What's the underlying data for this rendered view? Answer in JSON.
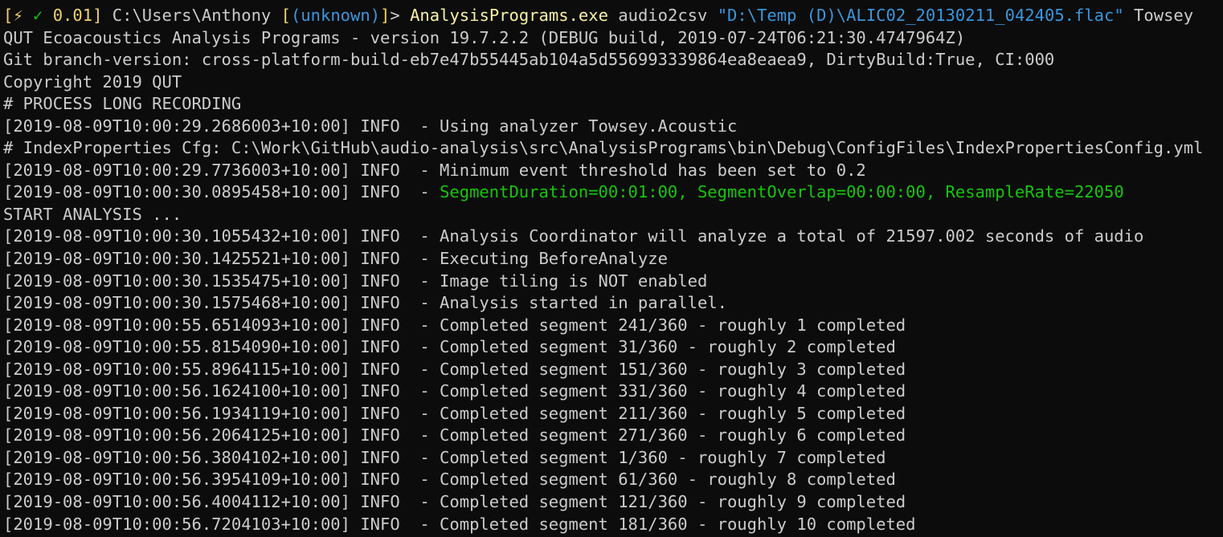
{
  "prompt": {
    "open_bracket": "[",
    "bolt": "⚡",
    "check": "✓",
    "duration": "0.01",
    "close_bracket": "]",
    "path": " C:\\Users\\Anthony ",
    "git_open": "[",
    "git_status": "(unknown)",
    "git_close": "]",
    "gt": "> ",
    "executable": "AnalysisPrograms.exe",
    "args_before": " audio2csv ",
    "quoted_arg": "\"D:\\Temp (D)\\ALIC02_20130211_042405.flac\"",
    "args_after": " Towsey"
  },
  "output": {
    "line_1": "QUT Ecoacoustics Analysis Programs - version 19.7.2.2 (DEBUG build, 2019-07-24T06:21:30.4747964Z)",
    "line_2": "Git branch-version: cross-platform-build-eb7e47b55445ab104a5d556993339864ea8eaea9, DirtyBuild:True, CI:000",
    "line_3": "Copyright 2019 QUT",
    "line_4": "# PROCESS LONG RECORDING",
    "line_5": "[2019-08-09T10:00:29.2686003+10:00] INFO  - Using analyzer Towsey.Acoustic",
    "line_6": "# IndexProperties Cfg: C:\\Work\\GitHub\\audio-analysis\\src\\AnalysisPrograms\\bin\\Debug\\ConfigFiles\\IndexPropertiesConfig.yml",
    "line_7": "[2019-08-09T10:00:29.7736003+10:00] INFO  - Minimum event threshold has been set to 0.2",
    "line_8_prefix": "[2019-08-09T10:00:30.0895458+10:00] INFO  - ",
    "line_8_highlight": "SegmentDuration=00:01:00, SegmentOverlap=00:00:00, ResampleRate=22050",
    "line_9": "START ANALYSIS ...",
    "line_10": "[2019-08-09T10:00:30.1055432+10:00] INFO  - Analysis Coordinator will analyze a total of 21597.002 seconds of audio",
    "line_11": "[2019-08-09T10:00:30.1425521+10:00] INFO  - Executing BeforeAnalyze",
    "line_12": "[2019-08-09T10:00:30.1535475+10:00] INFO  - Image tiling is NOT enabled",
    "line_13": "[2019-08-09T10:00:30.1575468+10:00] INFO  - Analysis started in parallel.",
    "line_14": "[2019-08-09T10:00:55.6514093+10:00] INFO  - Completed segment 241/360 - roughly 1 completed",
    "line_15": "[2019-08-09T10:00:55.8154090+10:00] INFO  - Completed segment 31/360 - roughly 2 completed",
    "line_16": "[2019-08-09T10:00:55.8964115+10:00] INFO  - Completed segment 151/360 - roughly 3 completed",
    "line_17": "[2019-08-09T10:00:56.1624100+10:00] INFO  - Completed segment 331/360 - roughly 4 completed",
    "line_18": "[2019-08-09T10:00:56.1934119+10:00] INFO  - Completed segment 211/360 - roughly 5 completed",
    "line_19": "[2019-08-09T10:00:56.2064125+10:00] INFO  - Completed segment 271/360 - roughly 6 completed",
    "line_20": "[2019-08-09T10:00:56.3804102+10:00] INFO  - Completed segment 1/360 - roughly 7 completed",
    "line_21": "[2019-08-09T10:00:56.3954109+10:00] INFO  - Completed segment 61/360 - roughly 8 completed",
    "line_22": "[2019-08-09T10:00:56.4004112+10:00] INFO  - Completed segment 121/360 - roughly 9 completed",
    "line_23": "[2019-08-09T10:00:56.7204103+10:00] INFO  - Completed segment 181/360 - roughly 10 completed"
  },
  "colors": {
    "background": "#0c0c0c",
    "foreground": "#cccccc",
    "prompt_yellow": "#f0d26b",
    "success_green": "#16c60c",
    "string_blue": "#3a96dd",
    "command_yellow": "#f9f1a5"
  }
}
